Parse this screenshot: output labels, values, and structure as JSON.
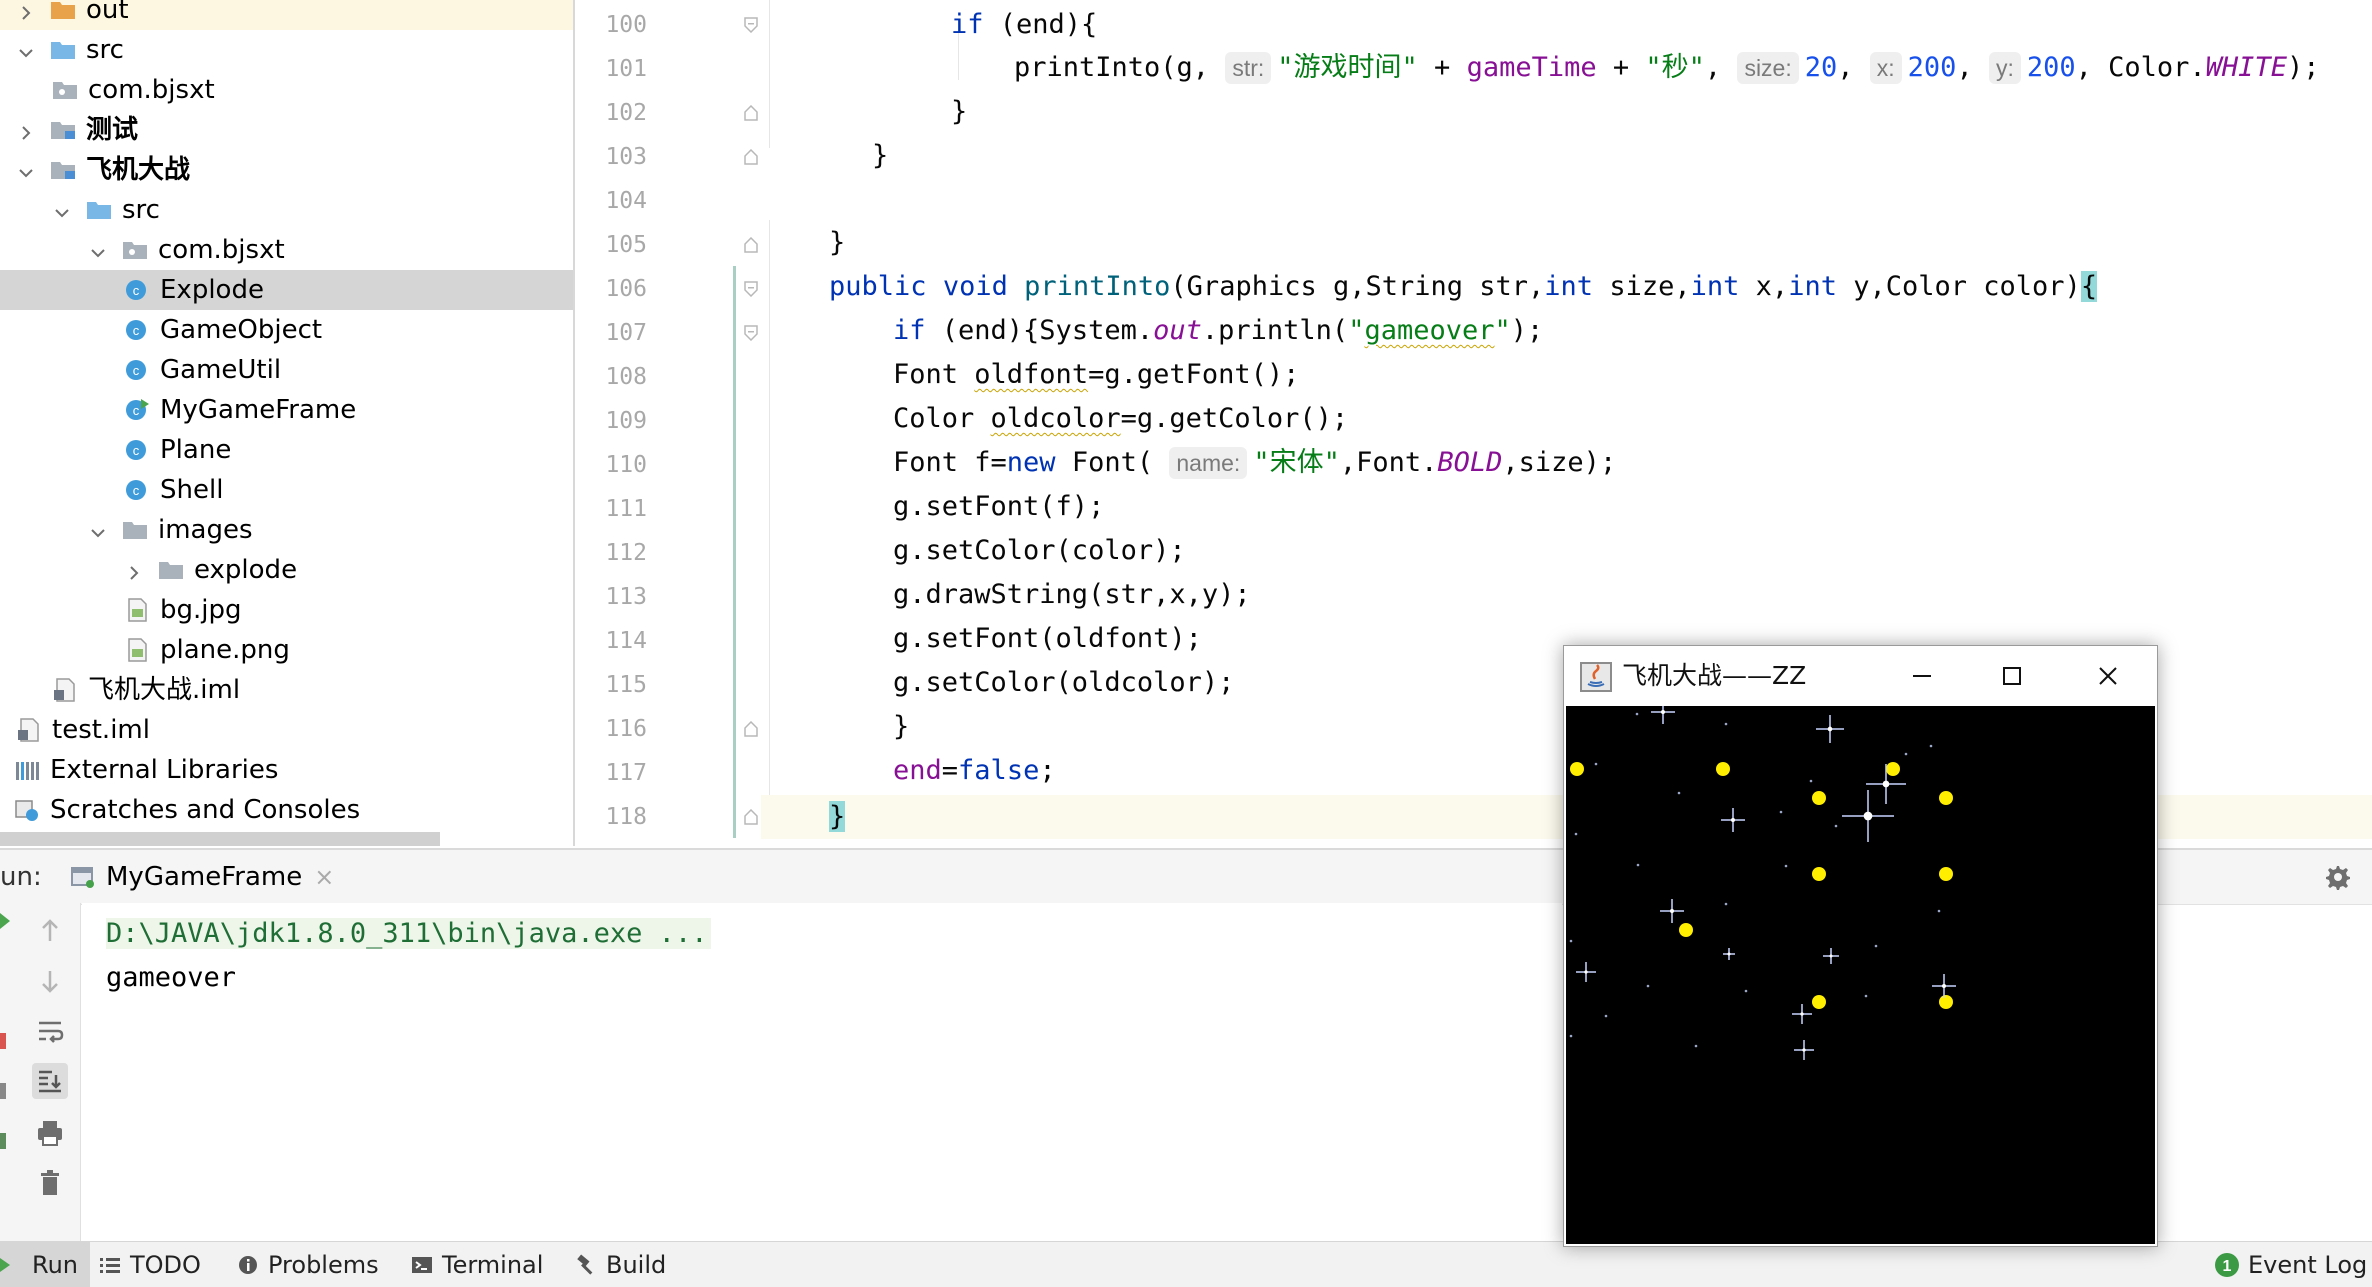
{
  "project_tree": {
    "items": [
      {
        "label": "out",
        "kind": "folder-orange",
        "chevron": "right",
        "bold": false
      },
      {
        "label": "src",
        "kind": "folder-blue",
        "chevron": "down",
        "bold": false
      },
      {
        "label": "com.bjsxt",
        "kind": "package",
        "chevron": "none",
        "bold": false
      },
      {
        "label": "测试",
        "kind": "module",
        "chevron": "right",
        "bold": true
      },
      {
        "label": "飞机大战",
        "kind": "module",
        "chevron": "down",
        "bold": true
      },
      {
        "label": "src",
        "kind": "folder-blue",
        "chevron": "down",
        "bold": false
      },
      {
        "label": "com.bjsxt",
        "kind": "package",
        "chevron": "down",
        "bold": false
      },
      {
        "label": "Explode",
        "kind": "class",
        "chevron": "none",
        "bold": false
      },
      {
        "label": "GameObject",
        "kind": "class",
        "chevron": "none",
        "bold": false
      },
      {
        "label": "GameUtil",
        "kind": "class",
        "chevron": "none",
        "bold": false
      },
      {
        "label": "MyGameFrame",
        "kind": "class-main",
        "chevron": "none",
        "bold": false
      },
      {
        "label": "Plane",
        "kind": "class",
        "chevron": "none",
        "bold": false
      },
      {
        "label": "Shell",
        "kind": "class",
        "chevron": "none",
        "bold": false
      },
      {
        "label": "images",
        "kind": "folder-gray",
        "chevron": "down",
        "bold": false
      },
      {
        "label": "explode",
        "kind": "folder-gray",
        "chevron": "right",
        "bold": false
      },
      {
        "label": "bg.jpg",
        "kind": "image-file",
        "chevron": "none",
        "bold": false
      },
      {
        "label": "plane.png",
        "kind": "image-file",
        "chevron": "none",
        "bold": false
      },
      {
        "label": "飞机大战.iml",
        "kind": "iml-file",
        "chevron": "none",
        "bold": false
      },
      {
        "label": "test.iml",
        "kind": "iml-file",
        "chevron": "none",
        "bold": false
      },
      {
        "label": "External Libraries",
        "kind": "libraries",
        "chevron": "none",
        "bold": false
      },
      {
        "label": "Scratches and Consoles",
        "kind": "scratches",
        "chevron": "none",
        "bold": false
      }
    ],
    "selected_label": "Explode"
  },
  "editor": {
    "line_numbers": [
      "100",
      "101",
      "102",
      "103",
      "104",
      "105",
      "106",
      "107",
      "108",
      "109",
      "110",
      "111",
      "112",
      "113",
      "114",
      "115",
      "116",
      "117",
      "118"
    ],
    "current_line": "118",
    "code": {
      "l100_kw": "if",
      "l100_rest": " (end){",
      "l101_fn": "printInto(g, ",
      "l101_hint_str": "str:",
      "l101_str1": "\"游戏时间\"",
      "l101_plus1": " + ",
      "l101_var": "gameTime",
      "l101_plus2": " + ",
      "l101_str2": "\"秒\"",
      "l101_comma1": ", ",
      "l101_hint_size": "size:",
      "l101_num1": "20",
      "l101_comma2": ", ",
      "l101_hint_x": "x:",
      "l101_num2": "200",
      "l101_comma3": ", ",
      "l101_hint_y": "y:",
      "l101_num3": "200",
      "l101_color": ", Color.",
      "l101_white": "WHITE",
      "l101_end": ");",
      "l102": "}",
      "l103": "}",
      "l105": "}",
      "l106_kw1": "public",
      "l106_kw2": "void",
      "l106_fn": "printInto",
      "l106_p1": "(Graphics g,String str,",
      "l106_int1": "int",
      "l106_p2": " size,",
      "l106_int2": "int",
      "l106_p3": " x,",
      "l106_int3": "int",
      "l106_p4": " y,Color color)",
      "l106_brace": "{",
      "l107_kw": "if",
      "l107_a": " (end){System.",
      "l107_out": "out",
      "l107_b": ".println(",
      "l107_str_q1": "\"",
      "l107_str_word": "gameover",
      "l107_str_q2": "\"",
      "l107_c": ");",
      "l108_a": "Font ",
      "l108_var": "oldfont",
      "l108_b": "=g.getFont();",
      "l109_a": "Color ",
      "l109_var": "oldcolor",
      "l109_b": "=g.getColor();",
      "l110_a": "Font f=",
      "l110_kw": "new",
      "l110_b": " Font( ",
      "l110_hint": "name:",
      "l110_str": "\"宋体\"",
      "l110_c": ",Font.",
      "l110_bold": "BOLD",
      "l110_d": ",size);",
      "l111": "g.setFont(f);",
      "l112": "g.setColor(color);",
      "l113": "g.drawString(str,x,y);",
      "l114": "g.setFont(oldfont);",
      "l115": "g.setColor(oldcolor);",
      "l116": "}",
      "l117_var": "end",
      "l117_eq": "=",
      "l117_kw": "false",
      "l117_end": ";",
      "l118": "}"
    }
  },
  "run_panel": {
    "label": "un:",
    "tab_label": "MyGameFrame",
    "close_glyph": "×",
    "console_lines": [
      "D:\\JAVA\\jdk1.8.0_311\\bin\\java.exe ...",
      "gameover"
    ]
  },
  "status_bar": {
    "run": "Run",
    "todo": "TODO",
    "problems": "Problems",
    "terminal": "Terminal",
    "build": "Build",
    "event_log": "Event Log",
    "event_log_count": "1"
  },
  "game_window": {
    "title": "飞机大战——ZZ",
    "minimize_icon": "minimize-icon",
    "maximize_icon": "maximize-icon",
    "close_icon": "close-icon",
    "background_color": "#000000",
    "bullet_color": "#ffee00",
    "bullet_count": 12,
    "star_color": "#c8d4ff"
  },
  "colors": {
    "keyword": "#0033b3",
    "function": "#00627a",
    "string": "#067d17",
    "number": "#1750eb",
    "static_field": "#871094",
    "console_command": "#1f6e35"
  }
}
